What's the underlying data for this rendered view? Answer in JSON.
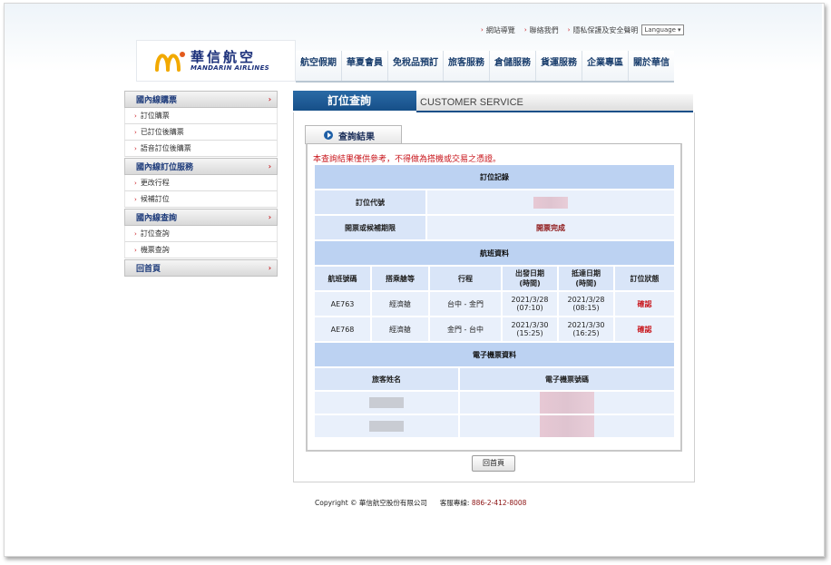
{
  "top_links": [
    "網站導覽",
    "聯絡我們",
    "隱私保護及安全聲明"
  ],
  "language_select": "Language",
  "logo": {
    "cn": "華信航空",
    "en": "MANDARIN AIRLINES"
  },
  "nav": [
    "航空假期",
    "華夏會員",
    "免稅品預訂",
    "旅客服務",
    "倉儲服務",
    "貨運服務",
    "企業專區",
    "關於華信"
  ],
  "sidebar": {
    "sections": [
      {
        "title": "國內線購票",
        "items": [
          "訂位購票",
          "已訂位後購票",
          "語音訂位後購票"
        ]
      },
      {
        "title": "國內線訂位服務",
        "items": [
          "更改行程",
          "候補訂位"
        ]
      },
      {
        "title": "國內線查詢",
        "items": [
          "訂位查詢",
          "機票查詢"
        ]
      },
      {
        "title": "回首頁",
        "items": []
      }
    ]
  },
  "main": {
    "tab_title": "訂位查詢",
    "tab_en": "CUSTOMER SERVICE",
    "subtab": "查詢結果",
    "notice": "本查詢結果僅供參考，不得做為搭機或交易之憑證。"
  },
  "booking": {
    "header": "訂位記錄",
    "code_label": "訂位代號",
    "deadline_label": "開票或候補期限",
    "deadline_value": "開票完成"
  },
  "flights": {
    "header": "航班資料",
    "columns": [
      "航班號碼",
      "搭乘艙等",
      "行程",
      "出發日期\n(時間)",
      "抵達日期\n(時間)",
      "訂位狀態"
    ],
    "rows": [
      {
        "flight": "AE763",
        "cabin": "經濟艙",
        "route": "台中 - 金門",
        "dep_date": "2021/3/28",
        "dep_time": "(07:10)",
        "arr_date": "2021/3/28",
        "arr_time": "(08:15)",
        "status": "確認"
      },
      {
        "flight": "AE768",
        "cabin": "經濟艙",
        "route": "金門 - 台中",
        "dep_date": "2021/3/30",
        "dep_time": "(15:25)",
        "arr_date": "2021/3/30",
        "arr_time": "(16:25)",
        "status": "確認"
      }
    ]
  },
  "eticket": {
    "header": "電子機票資料",
    "name_label": "旅客姓名",
    "number_label": "電子機票號碼"
  },
  "home_button": "回首頁",
  "footer": {
    "copyright": "Copyright © 華信航空股份有限公司",
    "hotline_label": "客服專線:",
    "hotline": "886-2-412-8008"
  },
  "colors": {
    "brand_blue": "#164f88",
    "accent_red": "#c8151b",
    "table_header": "#bcd2f2"
  }
}
